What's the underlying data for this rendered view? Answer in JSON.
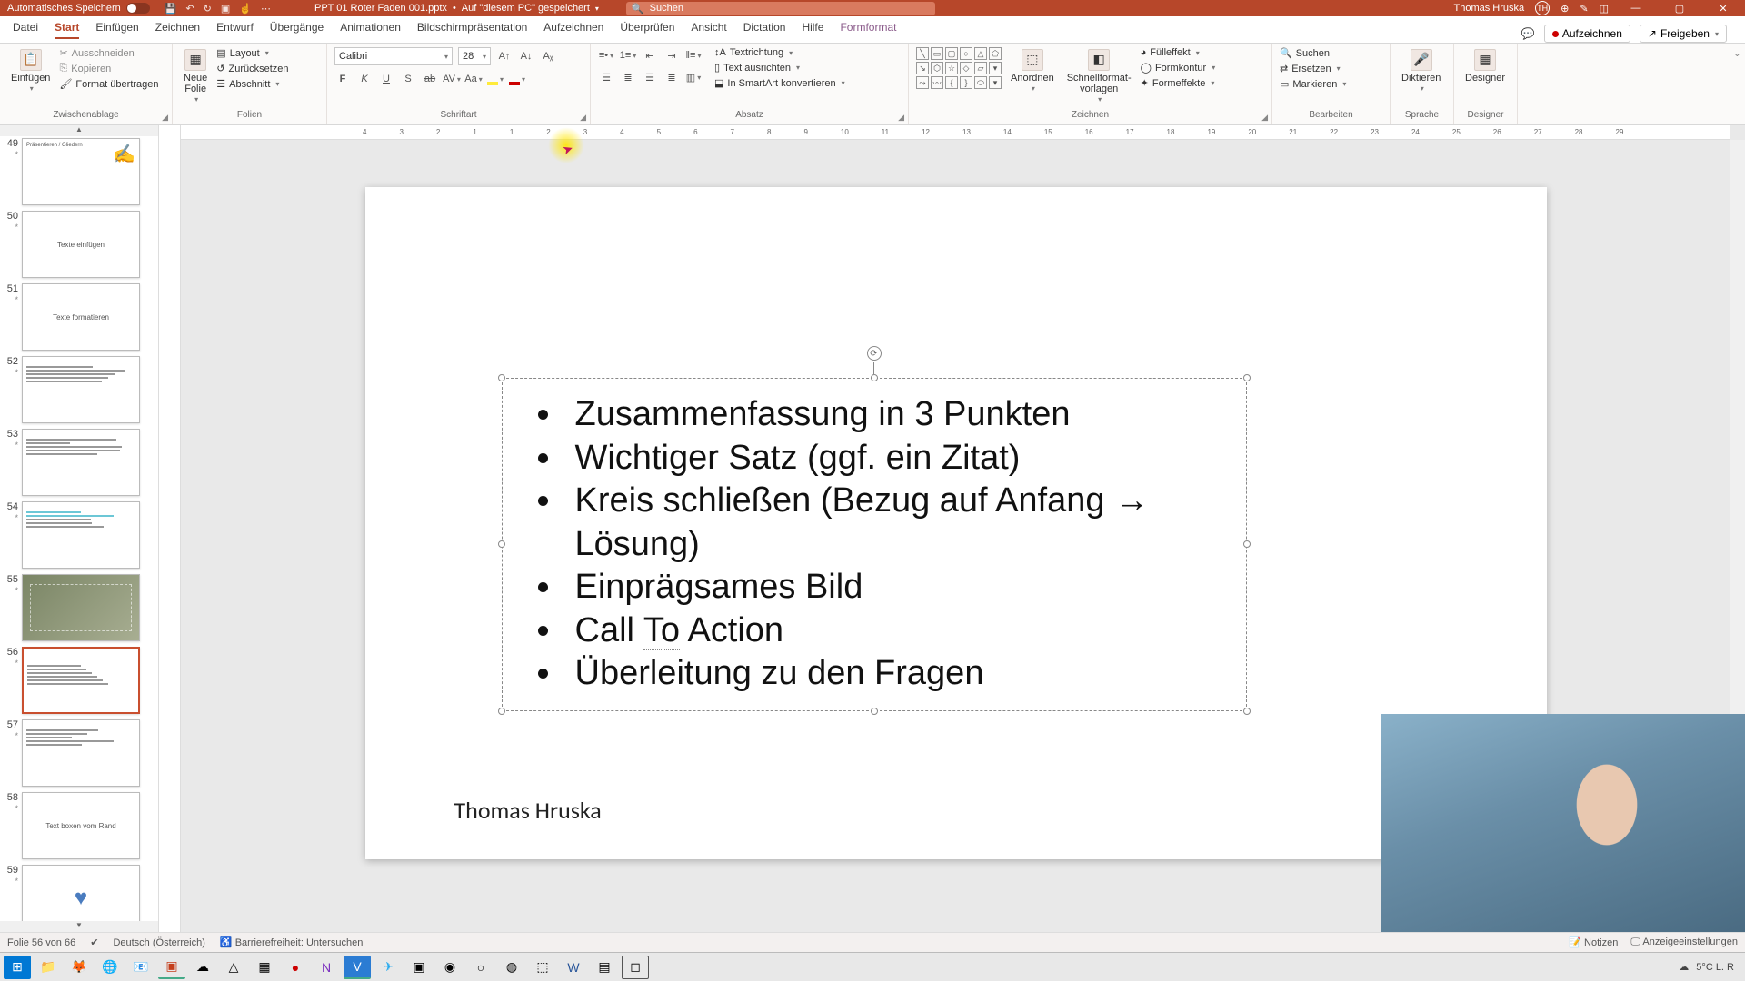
{
  "titlebar": {
    "auto_save": "Automatisches Speichern",
    "filename": "PPT 01 Roter Faden 001.pptx",
    "location": "Auf \"diesem PC\" gespeichert",
    "search_placeholder": "Suchen",
    "user_name": "Thomas Hruska",
    "user_initials": "TH"
  },
  "tabs": {
    "datei": "Datei",
    "start": "Start",
    "einfuegen": "Einfügen",
    "zeichnen": "Zeichnen",
    "entwurf": "Entwurf",
    "uebergaenge": "Übergänge",
    "animationen": "Animationen",
    "bildschirm": "Bildschirmpräsentation",
    "aufzeichnen_tab": "Aufzeichnen",
    "ueberpruefen": "Überprüfen",
    "ansicht": "Ansicht",
    "dictation": "Dictation",
    "hilfe": "Hilfe",
    "formformat": "Formformat",
    "aufzeichnen_btn": "Aufzeichnen",
    "freigeben": "Freigeben"
  },
  "ribbon": {
    "clipboard": {
      "paste": "Einfügen",
      "cut": "Ausschneiden",
      "copy": "Kopieren",
      "format_painter": "Format übertragen",
      "label": "Zwischenablage"
    },
    "slides": {
      "new_slide": "Neue\nFolie",
      "layout": "Layout",
      "reset": "Zurücksetzen",
      "section": "Abschnitt",
      "label": "Folien"
    },
    "font": {
      "name": "Calibri",
      "size": "28",
      "label": "Schriftart"
    },
    "paragraph": {
      "text_direction": "Textrichtung",
      "align_text": "Text ausrichten",
      "smartart": "In SmartArt konvertieren",
      "label": "Absatz"
    },
    "drawing": {
      "arrange": "Anordnen",
      "quick_styles": "Schnellformat-\nvorlagen",
      "fill": "Fülleffekt",
      "outline": "Formkontur",
      "effects": "Formeffekte",
      "label": "Zeichnen"
    },
    "editing": {
      "find": "Suchen",
      "replace": "Ersetzen",
      "select": "Markieren",
      "label": "Bearbeiten"
    },
    "voice": {
      "dictate": "Diktieren",
      "label": "Sprache"
    },
    "designer": {
      "btn": "Designer",
      "label": "Designer"
    }
  },
  "ruler_ticks": [
    "4",
    "3",
    "2",
    "1",
    "1",
    "2",
    "3",
    "4",
    "5",
    "6",
    "7",
    "8",
    "9",
    "10",
    "11",
    "12",
    "13",
    "14",
    "15",
    "16",
    "17",
    "18",
    "19",
    "20",
    "21",
    "22",
    "23",
    "24",
    "25",
    "26",
    "27",
    "28",
    "29"
  ],
  "thumbnails": [
    {
      "num": "49",
      "kind": "img-hand"
    },
    {
      "num": "50",
      "kind": "center",
      "text": "Texte einfügen"
    },
    {
      "num": "51",
      "kind": "center",
      "text": "Texte formatieren"
    },
    {
      "num": "52",
      "kind": "lines"
    },
    {
      "num": "53",
      "kind": "lines"
    },
    {
      "num": "54",
      "kind": "highlight"
    },
    {
      "num": "55",
      "kind": "photo"
    },
    {
      "num": "56",
      "kind": "bullets",
      "active": true
    },
    {
      "num": "57",
      "kind": "grid"
    },
    {
      "num": "58",
      "kind": "center",
      "text": "Text boxen\nvom Rand"
    },
    {
      "num": "59",
      "kind": "heart"
    }
  ],
  "slide": {
    "bullets": [
      "Zusammenfassung in 3 Punkten",
      "Wichtiger Satz (ggf. ein Zitat)",
      "Kreis schließen (Bezug auf Anfang → Lösung)",
      "Einprägsames Bild",
      "Call To Action",
      "Überleitung zu den Fragen"
    ],
    "author": "Thomas Hruska"
  },
  "statusbar": {
    "slide_info": "Folie 56 von 66",
    "language": "Deutsch (Österreich)",
    "accessibility": "Barrierefreiheit: Untersuchen",
    "notes": "Notizen",
    "display_settings": "Anzeigeeinstellungen"
  },
  "taskbar": {
    "weather": "5°C  L. R"
  }
}
